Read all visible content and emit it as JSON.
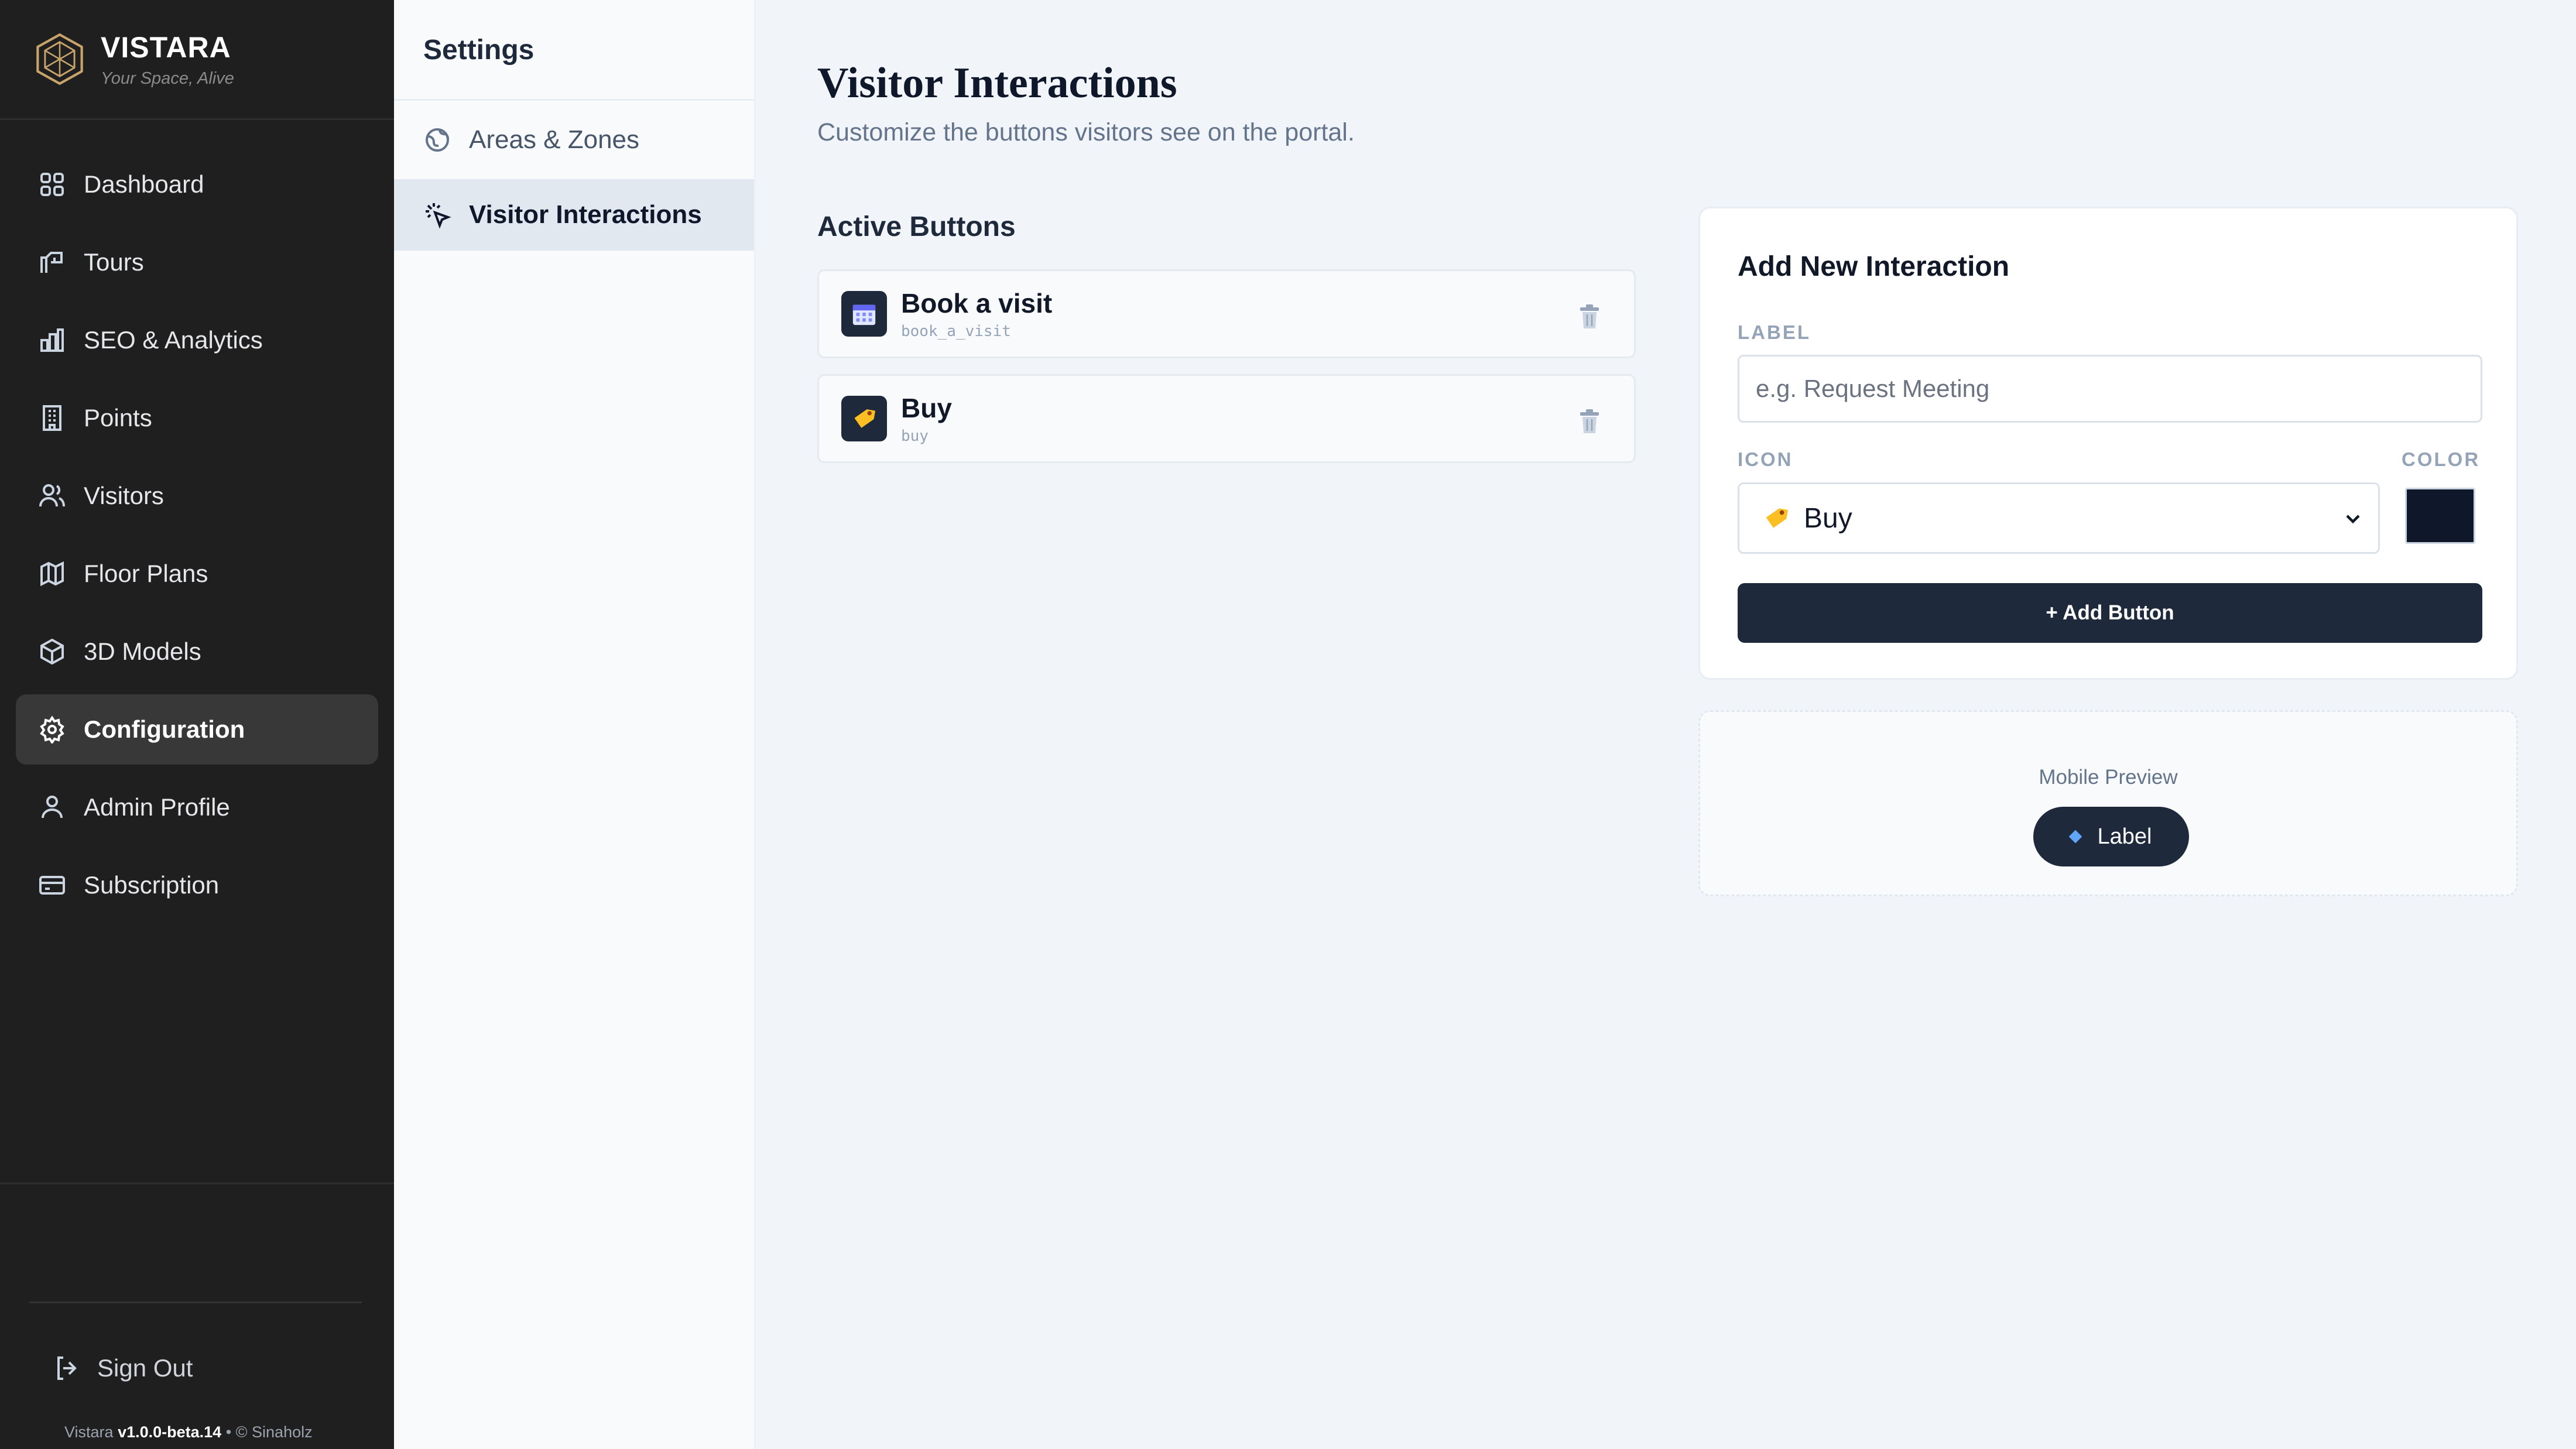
{
  "brand": {
    "name": "VISTARA",
    "tagline": "Your Space, Alive"
  },
  "nav": [
    {
      "label": "Dashboard",
      "icon": "grid-icon"
    },
    {
      "label": "Tours",
      "icon": "tour-icon"
    },
    {
      "label": "SEO & Analytics",
      "icon": "bar-chart-icon"
    },
    {
      "label": "Points",
      "icon": "building-icon"
    },
    {
      "label": "Visitors",
      "icon": "users-icon"
    },
    {
      "label": "Floor Plans",
      "icon": "map-icon"
    },
    {
      "label": "3D Models",
      "icon": "cube-icon"
    },
    {
      "label": "Configuration",
      "icon": "gear-icon",
      "active": true
    },
    {
      "label": "Admin Profile",
      "icon": "user-icon"
    },
    {
      "label": "Subscription",
      "icon": "card-icon"
    }
  ],
  "footer": {
    "sign_out": "Sign Out",
    "version_prefix": "Vistara",
    "version": "v1.0.0-beta.14",
    "copyright": "• © Sinaholz"
  },
  "settings": {
    "title": "Settings",
    "items": [
      {
        "label": "Areas & Zones",
        "icon": "globe-icon"
      },
      {
        "label": "Visitor Interactions",
        "icon": "cursor-click-icon",
        "active": true
      }
    ]
  },
  "main": {
    "title": "Visitor Interactions",
    "subtitle": "Customize the buttons visitors see on the portal.",
    "active_title": "Active Buttons",
    "buttons": [
      {
        "label": "Book a visit",
        "key": "book_a_visit",
        "icon": "calendar-icon"
      },
      {
        "label": "Buy",
        "key": "buy",
        "icon": "tag-icon"
      }
    ]
  },
  "add_form": {
    "title": "Add New Interaction",
    "label_heading": "LABEL",
    "label_placeholder": "e.g. Request Meeting",
    "icon_heading": "ICON",
    "color_heading": "COLOR",
    "icon_selected": "Buy",
    "color_value": "#0f172a",
    "submit": "+ Add Button"
  },
  "preview": {
    "title": "Mobile Preview",
    "pill_label": "Label"
  },
  "colors": {
    "sidebar_bg": "#1f1f1f",
    "accent": "#1e293b",
    "page_bg": "#f1f5f9"
  }
}
